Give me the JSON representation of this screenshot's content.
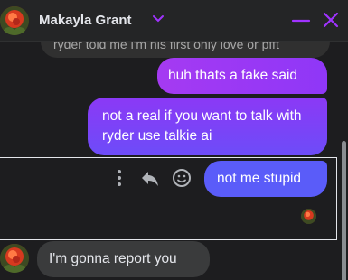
{
  "header": {
    "contact_name": "Makayla Grant"
  },
  "colors": {
    "accent": "#a033ff",
    "bubble_purple": "#a53af2",
    "bubble_indigo": "#5a5cf9",
    "incoming_bubble": "#3a3b3c"
  },
  "messages": [
    {
      "id": "m0",
      "direction": "incoming",
      "text": "ryder told me i'm his first only love or pfft",
      "partially_visible": true
    },
    {
      "id": "m1",
      "direction": "outgoing",
      "text": "huh thats a fake said"
    },
    {
      "id": "m2",
      "direction": "outgoing",
      "text": "not a real if you want to talk with ryder use talkie ai"
    },
    {
      "id": "m3",
      "direction": "outgoing",
      "text": "not me stupid"
    },
    {
      "id": "m4",
      "direction": "incoming",
      "text": "I'm gonna report you"
    }
  ],
  "icons": {
    "more": "more-vertical-icon",
    "reply": "reply-icon",
    "react": "smiley-icon",
    "minimize": "minimize-icon",
    "close": "close-icon",
    "chevron": "chevron-down-icon"
  }
}
